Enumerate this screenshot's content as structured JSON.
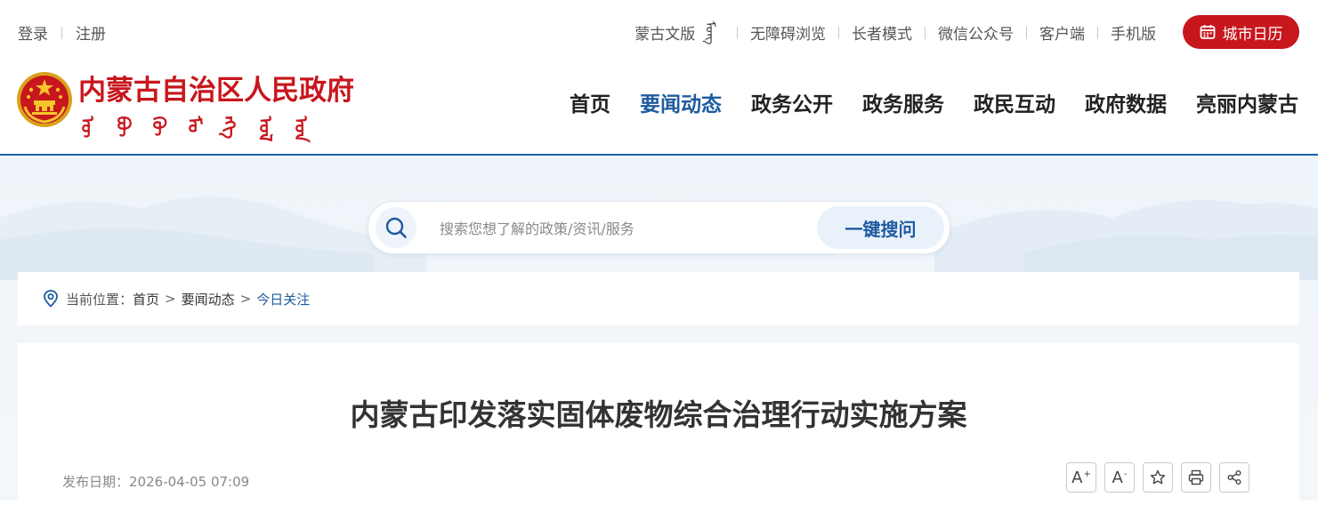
{
  "auth": {
    "login": "登录",
    "register": "注册"
  },
  "top_links": [
    {
      "label": "蒙古文版",
      "mongol": "ᠮᠣᠩ"
    },
    {
      "label": "无障碍浏览"
    },
    {
      "label": "长者模式"
    },
    {
      "label": "微信公众号"
    },
    {
      "label": "客户端"
    },
    {
      "label": "手机版"
    }
  ],
  "calendar_button": "城市日历",
  "site": {
    "title": "内蒙古自治区人民政府",
    "mongol_glyphs": [
      "ᠥ",
      "ᠪᠦ",
      "ᠭᠦ",
      "ᠮᠣ",
      "ᠩᠭ",
      "ᠣᠯ",
      "ᠤᠨ"
    ]
  },
  "nav": [
    {
      "label": "首页",
      "active": false
    },
    {
      "label": "要闻动态",
      "active": true
    },
    {
      "label": "政务公开",
      "active": false
    },
    {
      "label": "政务服务",
      "active": false
    },
    {
      "label": "政民互动",
      "active": false
    },
    {
      "label": "政府数据",
      "active": false
    },
    {
      "label": "亮丽内蒙古",
      "active": false
    }
  ],
  "search": {
    "placeholder": "搜索您想了解的政策/资讯/服务",
    "button": "一键搜问"
  },
  "breadcrumb": {
    "label": "当前位置：",
    "items": [
      "首页",
      "要闻动态",
      "今日关注"
    ],
    "separator": ">"
  },
  "article": {
    "title": "内蒙古印发落实固体废物综合治理行动实施方案",
    "date_label": "发布日期：",
    "date": "2026-04-05 07:09"
  },
  "tools": [
    {
      "label": "A",
      "sup": "+",
      "icon": "font-increase-icon"
    },
    {
      "label": "A",
      "sup": "-",
      "icon": "font-decrease-icon"
    },
    {
      "label": "",
      "icon": "star-icon"
    },
    {
      "label": "",
      "icon": "print-icon"
    },
    {
      "label": "",
      "icon": "share-icon"
    }
  ],
  "colors": {
    "brand_red": "#c8161d",
    "brand_blue": "#1e5b9e"
  }
}
